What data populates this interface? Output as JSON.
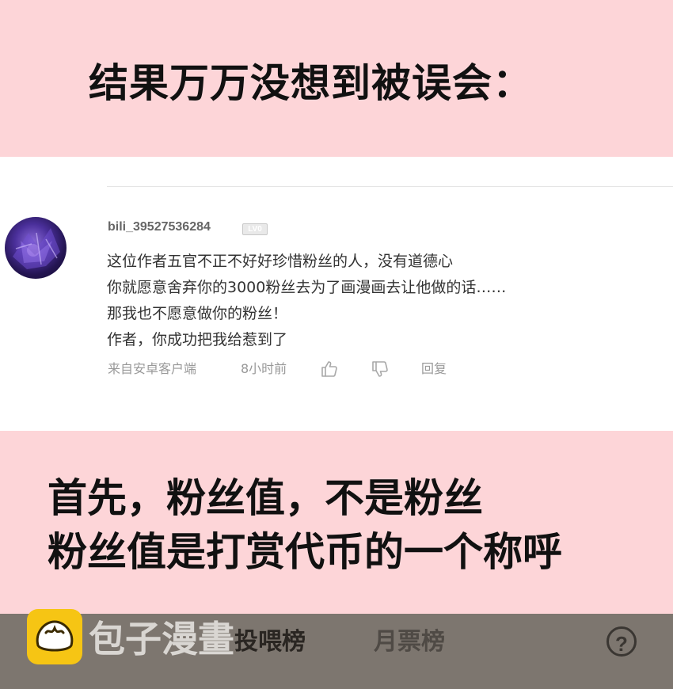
{
  "top_banner": {
    "heading": "结果万万没想到被误会："
  },
  "comment": {
    "username": "bili_39527536284",
    "level_badge": "LV0",
    "lines": [
      "这位作者五官不正不好好珍惜粉丝的人，没有道德心",
      "你就愿意舍弃你的3000粉丝去为了画漫画去让他做的话……",
      "那我也不愿意做你的粉丝！",
      "作者，你成功把我给惹到了"
    ],
    "source": "来自安卓客户端",
    "time": "8小时前",
    "reply_label": "回复",
    "icons": {
      "like": "thumbs-up-icon",
      "dislike": "thumbs-down-icon"
    }
  },
  "bottom_banner": {
    "lines": [
      "首先，粉丝值，不是粉丝",
      "粉丝值是打赏代币的一个称呼"
    ]
  },
  "bottom_bar": {
    "brand": "包子漫畫",
    "tabs": [
      "投喂榜",
      "月票榜"
    ],
    "help_label": "?",
    "colors": {
      "bar": "#7d766f",
      "logo": "#f6c514",
      "active_tab": "#2a2622",
      "inactive_tab": "#4f4a45"
    }
  },
  "colors": {
    "banner": "#fdd5d8",
    "panel": "#ffffff"
  }
}
